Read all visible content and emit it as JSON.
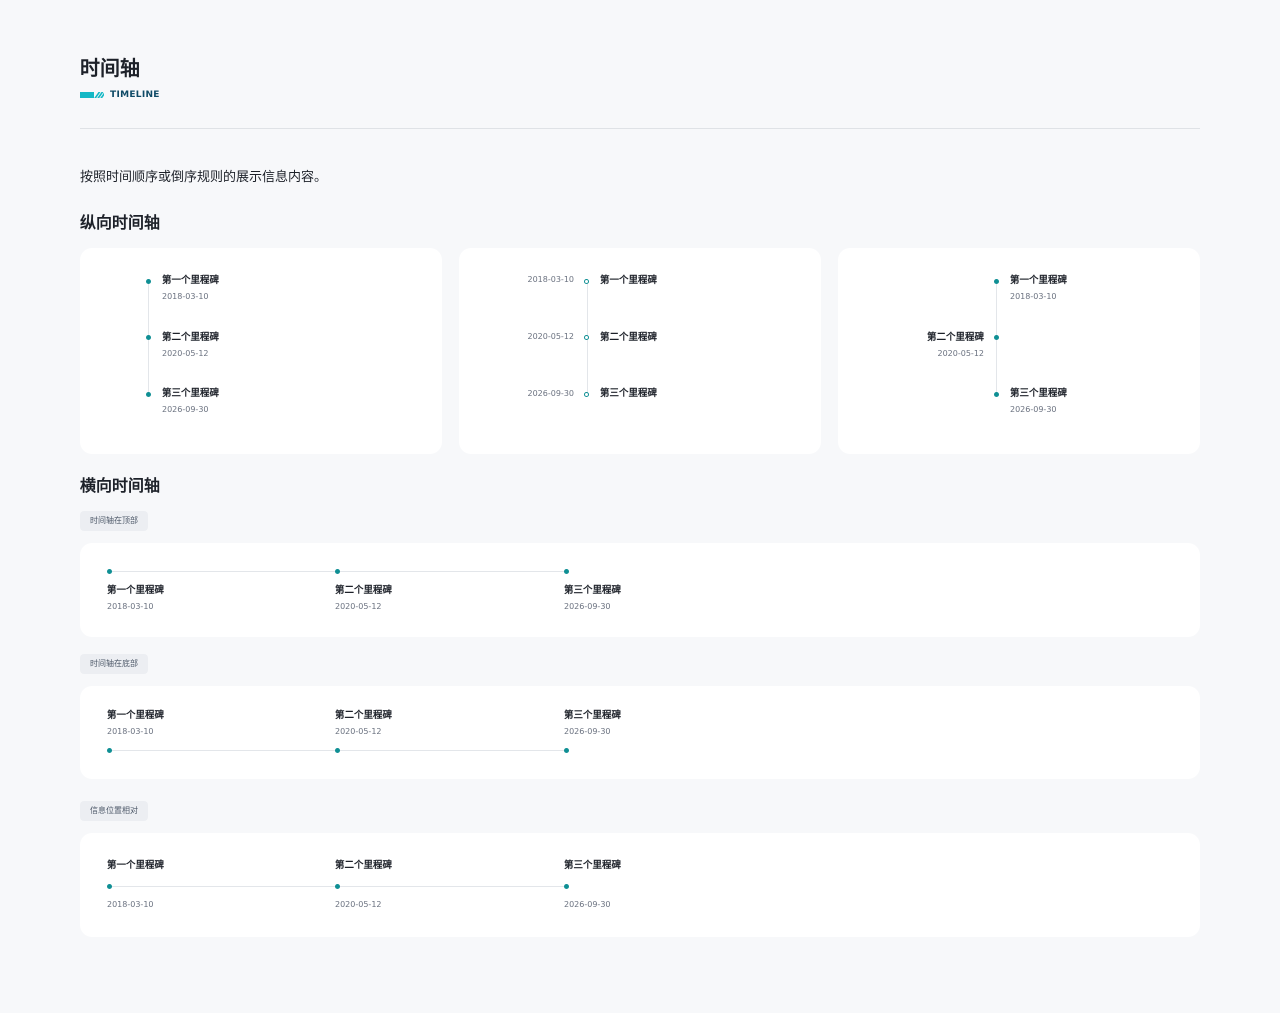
{
  "header": {
    "title": "时间轴",
    "subtitle": "TIMELINE",
    "accent_color": "#14b8c5"
  },
  "intro": "按照时间顺序或倒序规则的展示信息内容。",
  "vertical": {
    "title": "纵向时间轴"
  },
  "horizontal": {
    "title": "横向时间轴",
    "tag_top": "时间轴在顶部",
    "tag_bottom": "时间轴在底部",
    "tag_alternate": "信息位置相对"
  },
  "milestones": [
    {
      "title": "第一个里程碑",
      "date": "2018-03-10"
    },
    {
      "title": "第二个里程碑",
      "date": "2020-05-12"
    },
    {
      "title": "第三个里程碑",
      "date": "2026-09-30"
    }
  ],
  "colors": {
    "dot": "#0f8f94",
    "line": "#e3e6ea",
    "background": "#f7f8fa",
    "card": "#ffffff"
  }
}
